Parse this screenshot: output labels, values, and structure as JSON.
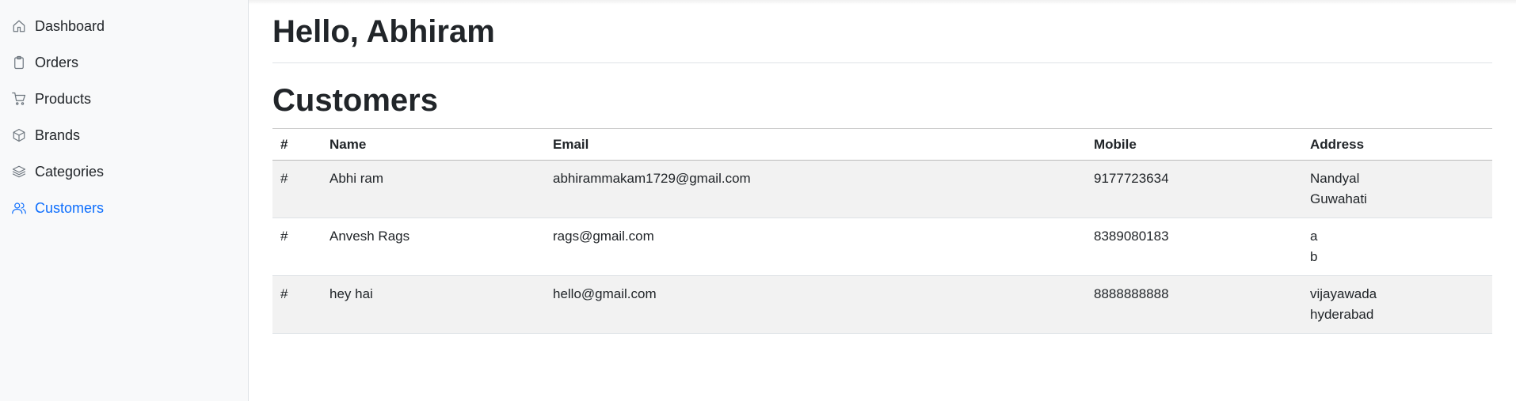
{
  "sidebar": {
    "items": [
      {
        "label": "Dashboard",
        "icon": "home-icon"
      },
      {
        "label": "Orders",
        "icon": "clipboard-icon"
      },
      {
        "label": "Products",
        "icon": "cart-icon"
      },
      {
        "label": "Brands",
        "icon": "box-icon"
      },
      {
        "label": "Categories",
        "icon": "layers-icon"
      },
      {
        "label": "Customers",
        "icon": "users-icon",
        "active": true
      }
    ]
  },
  "main": {
    "greeting": "Hello, Abhiram",
    "section_title": "Customers",
    "table": {
      "headers": [
        "#",
        "Name",
        "Email",
        "Mobile",
        "Address"
      ],
      "rows": [
        {
          "num": "#",
          "name": "Abhi ram",
          "email": "abhirammakam1729@gmail.com",
          "mobile": "9177723634",
          "address1": "Nandyal",
          "address2": "Guwahati"
        },
        {
          "num": "#",
          "name": "Anvesh Rags",
          "email": "rags@gmail.com",
          "mobile": "8389080183",
          "address1": "a",
          "address2": "b"
        },
        {
          "num": "#",
          "name": "hey hai",
          "email": "hello@gmail.com",
          "mobile": "8888888888",
          "address1": "vijayawada",
          "address2": "hyderabad"
        }
      ]
    }
  },
  "colors": {
    "accent": "#0d6efd",
    "sidebar_bg": "#f8f9fa",
    "striped_row": "#f2f2f2",
    "text": "#212529"
  }
}
